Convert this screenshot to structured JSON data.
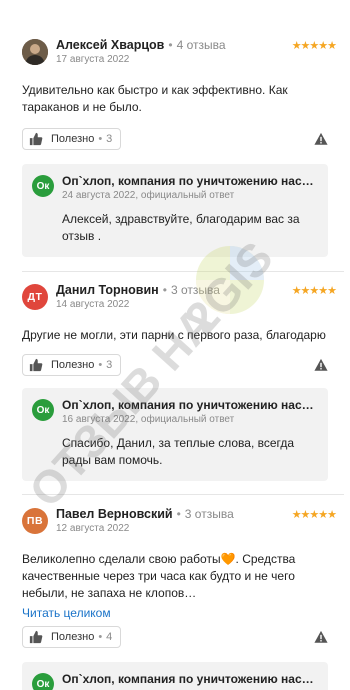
{
  "reviews": [
    {
      "author": "Алексей Хварцов",
      "avatar_initials": "",
      "avatar_color": "#5b4a3a",
      "review_count": "4 отзыва",
      "date": "17 августа 2022",
      "stars": "★★★★★",
      "text": "Удивительно как быстро и как эффективно. Как тараканов и не было.",
      "read_more": "",
      "useful_label": "Полезно",
      "useful_count": "3",
      "reply": {
        "company": "Оп`хлоп, компания по уничтожению нас…",
        "logo": "Ок",
        "meta": "24 августа 2022, официальный ответ",
        "text": "Алексей, здравствуйте, благодарим вас за отзыв ."
      }
    },
    {
      "author": "Данил Торновин",
      "avatar_initials": "ДТ",
      "avatar_color": "#e0463c",
      "review_count": "3 отзыва",
      "date": "14 августа 2022",
      "stars": "★★★★★",
      "text": "Другие не могли, эти парни с первого раза, благодарю",
      "read_more": "",
      "useful_label": "Полезно",
      "useful_count": "3",
      "reply": {
        "company": "Оп`хлоп, компания по уничтожению нас…",
        "logo": "Ок",
        "meta": "16 августа 2022, официальный ответ",
        "text": "Спасибо, Данил, за теплые слова, всегда рады вам помочь."
      }
    },
    {
      "author": "Павел Верновский",
      "avatar_initials": "ПВ",
      "avatar_color": "#d9743a",
      "review_count": "3 отзыва",
      "date": "12 августа 2022",
      "stars": "★★★★★",
      "text": "Великолепно сделали свою работы🧡. Средства качественные через три часа как будто и не чего небыли, не запаха не клопов…",
      "read_more": "Читать целиком",
      "useful_label": "Полезно",
      "useful_count": "4",
      "reply": {
        "company": "Оп`хлоп, компания по уничтожению нас…",
        "logo": "Ок",
        "meta": "",
        "text": ""
      }
    }
  ],
  "watermark": {
    "text": "ОТЗЫВ НА",
    "brand": "2GIS"
  },
  "colors": {
    "star": "#f5a623",
    "reply_bg": "#f2f2f2",
    "logo_green": "#2a9d3c",
    "link": "#1a73c8"
  }
}
